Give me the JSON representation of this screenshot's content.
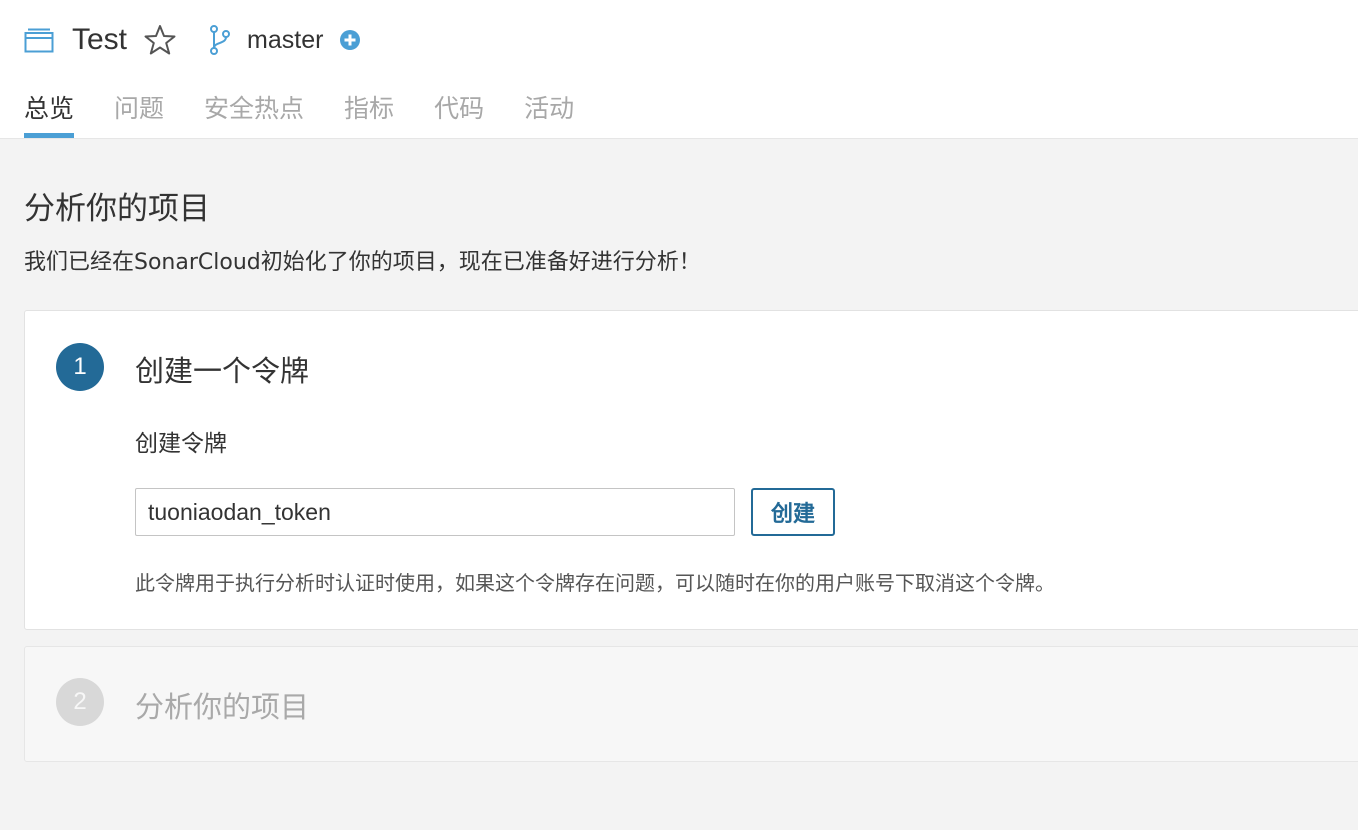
{
  "header": {
    "project_name": "Test",
    "branch_name": "master",
    "icons": {
      "project": "project-window-icon",
      "star": "star-outline-icon",
      "branch": "branch-icon",
      "add": "plus-circle-icon"
    }
  },
  "tabs": [
    {
      "label": "总览",
      "active": true
    },
    {
      "label": "问题",
      "active": false
    },
    {
      "label": "安全热点",
      "active": false
    },
    {
      "label": "指标",
      "active": false
    },
    {
      "label": "代码",
      "active": false
    },
    {
      "label": "活动",
      "active": false
    }
  ],
  "main": {
    "title": "分析你的项目",
    "subtitle": "我们已经在SonarCloud初始化了你的项目，现在已准备好进行分析！"
  },
  "steps": [
    {
      "number": "1",
      "title": "创建一个令牌",
      "field_label": "创建令牌",
      "input_value": "tuoniaodan_token",
      "button_label": "创建",
      "help_text": "此令牌用于执行分析时认证时使用，如果这个令牌存在问题，可以随时在你的用户账号下取消这个令牌。"
    },
    {
      "number": "2",
      "title": "分析你的项目"
    }
  ],
  "colors": {
    "accent": "#4b9fd5",
    "primary": "#236a97",
    "background": "#f3f3f3",
    "disabled": "#d8d8d8"
  }
}
